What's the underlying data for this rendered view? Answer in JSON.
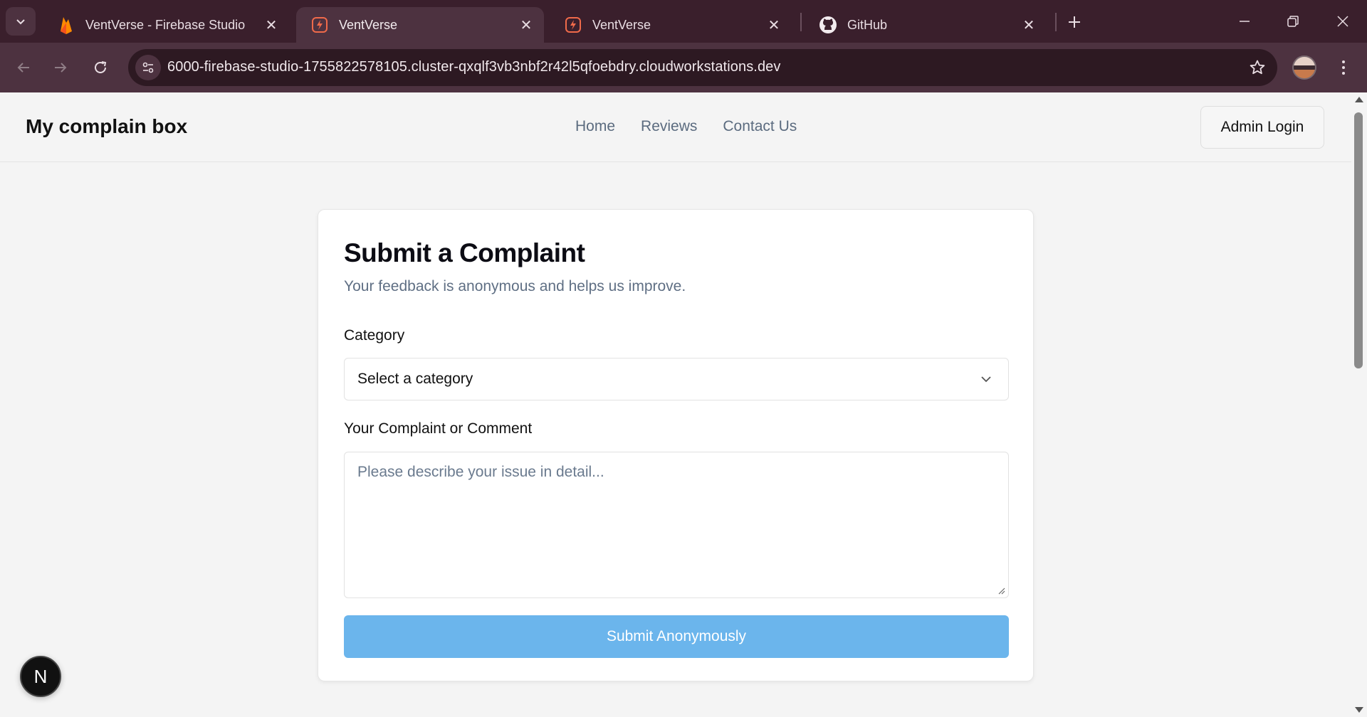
{
  "browser": {
    "tabs": [
      {
        "title": "VentVerse - Firebase Studio",
        "favicon": "firebase-icon"
      },
      {
        "title": "VentVerse",
        "favicon": "studio-icon",
        "active": true
      },
      {
        "title": "VentVerse",
        "favicon": "studio-icon"
      },
      {
        "title": "GitHub",
        "favicon": "github-icon"
      }
    ],
    "url": "6000-firebase-studio-1755822578105.cluster-qxqlf3vb3nbf2r42l5qfoebdry.cloudworkstations.dev"
  },
  "site": {
    "brand": "My complain box",
    "nav": [
      "Home",
      "Reviews",
      "Contact Us"
    ],
    "admin_login": "Admin Login"
  },
  "form": {
    "title": "Submit a Complaint",
    "subtitle": "Your feedback is anonymous and helps us improve.",
    "category_label": "Category",
    "category_value": "Select a category",
    "comment_label": "Your Complaint or Comment",
    "comment_placeholder": "Please describe your issue in detail...",
    "submit_label": "Submit Anonymously"
  },
  "badge": {
    "letter": "N"
  },
  "colors": {
    "accent": "#6bb5ec",
    "chrome_bg": "#3a1f2c",
    "toolbar_bg": "#4d3240"
  }
}
